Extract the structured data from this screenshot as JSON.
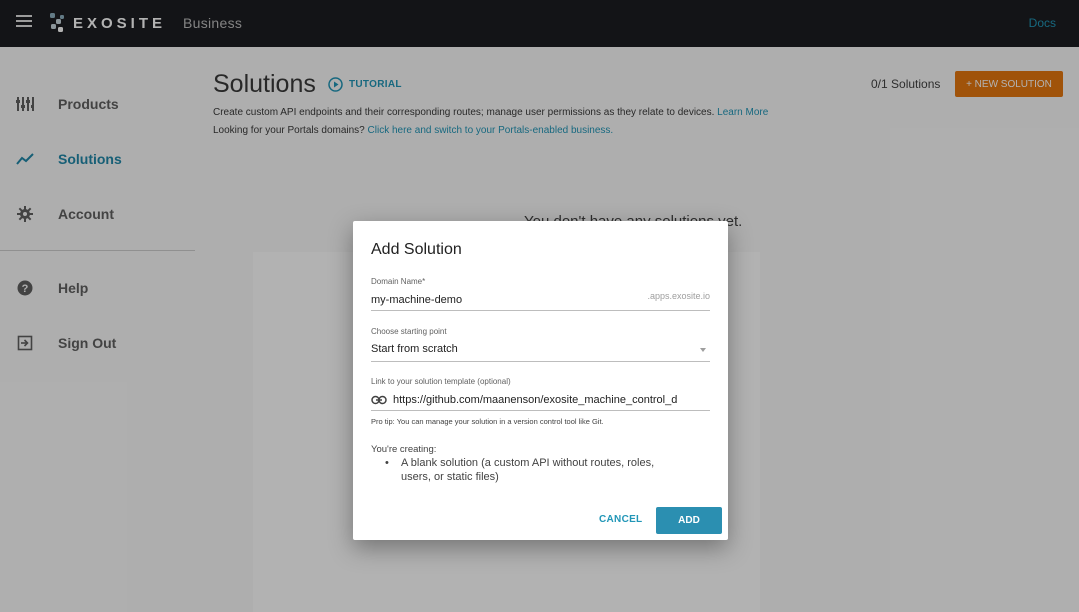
{
  "header": {
    "menu_icon": "hamburger-menu-icon",
    "logo_icon": "exosite-logo-icon",
    "logo_text": "EXOSITE",
    "business": "Business",
    "docs": "Docs"
  },
  "sidebar": {
    "items": [
      {
        "label": "Products",
        "icon": "products-icon",
        "active": false
      },
      {
        "label": "Solutions",
        "icon": "trending-line-icon",
        "active": true
      },
      {
        "label": "Account",
        "icon": "gear-icon",
        "active": false
      },
      {
        "label": "Help",
        "icon": "help-icon",
        "active": false
      },
      {
        "label": "Sign Out",
        "icon": "sign-out-icon",
        "active": false
      }
    ]
  },
  "main": {
    "title": "Solutions",
    "tutorial": "TUTORIAL",
    "count": "0/1 Solutions",
    "new_button": "+ NEW SOLUTION",
    "desc1": "Create custom API endpoints and their corresponding routes; manage user permissions as they relate to devices.",
    "learn_more": "Learn More",
    "desc2": "Looking for your Portals domains?",
    "portals_link": "Click here and switch to your Portals-enabled business.",
    "empty": "You don't have any solutions yet."
  },
  "dialog": {
    "title": "Add Solution",
    "domain_label": "Domain Name*",
    "domain_value": "my-machine-demo",
    "domain_suffix": ".apps.exosite.io",
    "start_label": "Choose starting point",
    "start_value": "Start from scratch",
    "template_label": "Link to your solution template (optional)",
    "template_value": "https://github.com/maanenson/exosite_machine_control_d",
    "tip": "Pro tip: You can manage your solution in a version control tool like Git.",
    "creating_label": "You're creating:",
    "creating_line1": "A blank solution (a custom API without routes, roles,",
    "creating_line2": "users, or static files)",
    "cancel": "CANCEL",
    "add": "ADD"
  },
  "colors": {
    "topbar": "#1c1e22",
    "accent": "#2196b7",
    "new_button": "#e6770f",
    "add_button": "#2b8fb1"
  }
}
